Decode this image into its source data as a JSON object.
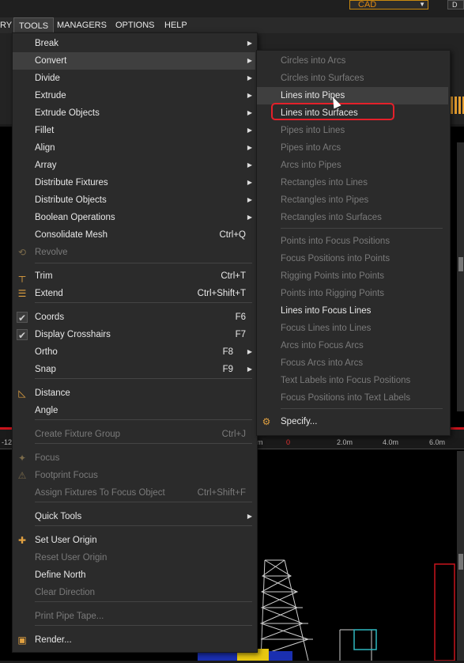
{
  "app": {
    "mode_select": "CAD",
    "corner_button": "D",
    "menubar": [
      "RY",
      "TOOLS",
      "MANAGERS",
      "OPTIONS",
      "HELP"
    ]
  },
  "ruler": [
    "-12",
    "m",
    "0",
    "2.0m",
    "4.0m",
    "6.0m"
  ],
  "tools_menu": [
    {
      "label": "Break",
      "submenu": true
    },
    {
      "label": "Convert",
      "submenu": true,
      "highlighted": true
    },
    {
      "label": "Divide",
      "submenu": true
    },
    {
      "label": "Extrude",
      "submenu": true
    },
    {
      "label": "Extrude Objects",
      "submenu": true
    },
    {
      "label": "Fillet",
      "submenu": true
    },
    {
      "label": "Align",
      "submenu": true
    },
    {
      "label": "Array",
      "submenu": true
    },
    {
      "label": "Distribute Fixtures",
      "submenu": true
    },
    {
      "label": "Distribute Objects",
      "submenu": true
    },
    {
      "label": "Boolean Operations",
      "submenu": true
    },
    {
      "label": "Consolidate Mesh",
      "shortcut": "Ctrl+Q"
    },
    {
      "label": "Revolve",
      "disabled": true,
      "icon": "revolve-icon"
    },
    {
      "label": "Trim",
      "shortcut": "Ctrl+T",
      "icon": "trim-icon"
    },
    {
      "label": "Extend",
      "shortcut": "Ctrl+Shift+T",
      "icon": "extend-icon"
    },
    {
      "label": "Coords",
      "shortcut": "F6",
      "checked": true
    },
    {
      "label": "Display Crosshairs",
      "shortcut": "F7",
      "checked": true
    },
    {
      "label": "Ortho",
      "shortcut": "F8",
      "submenu": true
    },
    {
      "label": "Snap",
      "shortcut": "F9",
      "submenu": true
    },
    {
      "label": "Distance",
      "icon": "distance-icon"
    },
    {
      "label": "Angle"
    },
    {
      "label": "Create Fixture Group",
      "shortcut": "Ctrl+J",
      "disabled": true
    },
    {
      "label": "Focus",
      "disabled": true,
      "icon": "focus-icon"
    },
    {
      "label": "Footprint Focus",
      "disabled": true,
      "icon": "footprint-icon"
    },
    {
      "label": "Assign Fixtures To Focus Object",
      "shortcut": "Ctrl+Shift+F",
      "disabled": true
    },
    {
      "label": "Quick Tools",
      "submenu": true
    },
    {
      "label": "Set User Origin",
      "icon": "origin-icon"
    },
    {
      "label": "Reset User Origin",
      "disabled": true
    },
    {
      "label": "Define North"
    },
    {
      "label": "Clear Direction",
      "disabled": true
    },
    {
      "label": "Print Pipe Tape...",
      "disabled": true
    },
    {
      "label": "Render...",
      "icon": "render-icon"
    }
  ],
  "convert_menu": [
    {
      "label": "Circles into Arcs",
      "disabled": true
    },
    {
      "label": "Circles into Surfaces",
      "disabled": true
    },
    {
      "label": "Lines into Pipes",
      "highlighted": true
    },
    {
      "label": "Lines into Surfaces",
      "outlined": true
    },
    {
      "label": "Pipes into Lines",
      "disabled": true
    },
    {
      "label": "Pipes into Arcs",
      "disabled": true
    },
    {
      "label": "Arcs into Pipes",
      "disabled": true
    },
    {
      "label": "Rectangles into Lines",
      "disabled": true
    },
    {
      "label": "Rectangles into Pipes",
      "disabled": true
    },
    {
      "label": "Rectangles into Surfaces",
      "disabled": true
    },
    {
      "label": "Points into Focus Positions",
      "disabled": true
    },
    {
      "label": "Focus Positions into Points",
      "disabled": true
    },
    {
      "label": "Rigging Points into Points",
      "disabled": true
    },
    {
      "label": "Points into Rigging Points",
      "disabled": true
    },
    {
      "label": "Lines into Focus Lines"
    },
    {
      "label": "Focus Lines into Lines",
      "disabled": true
    },
    {
      "label": "Arcs into Focus Arcs",
      "disabled": true
    },
    {
      "label": "Focus Arcs into Arcs",
      "disabled": true
    },
    {
      "label": "Text Labels into Focus Positions",
      "disabled": true
    },
    {
      "label": "Focus Positions into Text Labels",
      "disabled": true
    },
    {
      "label": "Specify...",
      "icon": "specify-icon"
    }
  ]
}
